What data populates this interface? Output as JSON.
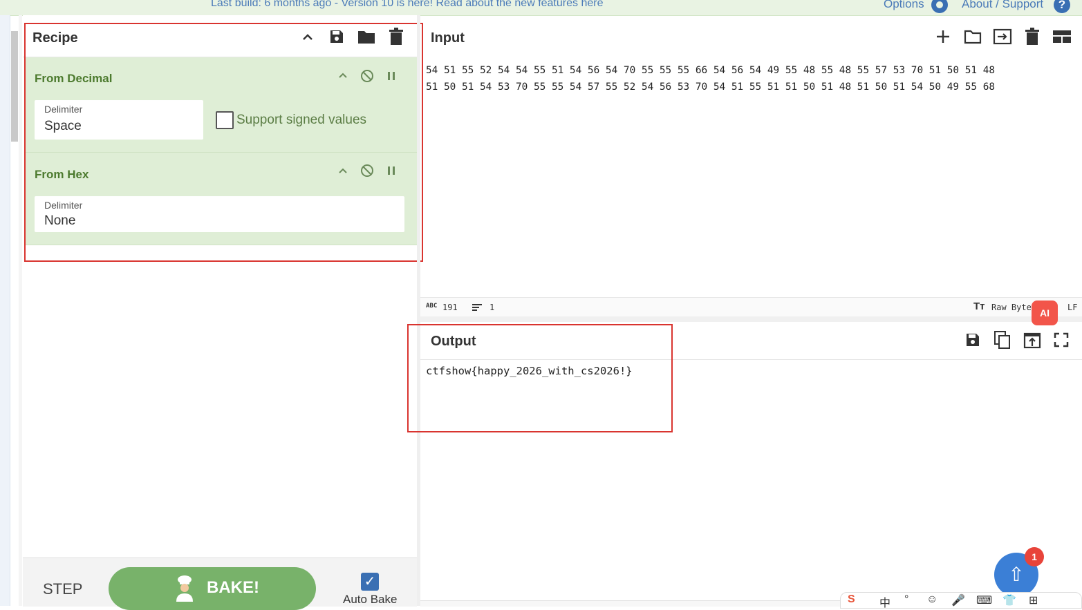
{
  "topbar": {
    "notice": "Last build: 6 months ago - Version 10 is here! Read about the new features",
    "notice_link": "here",
    "options_label": "Options",
    "about_label": "About / Support",
    "help_glyph": "?"
  },
  "recipe": {
    "title": "Recipe",
    "icons": [
      "chevron-up-icon",
      "save-icon",
      "folder-icon",
      "trash-icon"
    ],
    "operations": [
      {
        "title": "From Decimal",
        "delimiter_label": "Delimiter",
        "delimiter_value": "Space",
        "checkbox_label": "Support signed values",
        "checkbox_checked": false
      },
      {
        "title": "From Hex",
        "delimiter_label": "Delimiter",
        "delimiter_value": "None"
      }
    ],
    "step_label": "STEP",
    "bake_label": "BAKE!",
    "auto_bake_label": "Auto Bake",
    "auto_bake_checked": true
  },
  "input": {
    "title": "Input",
    "line1": "54 51 55 52 54 54 55 51 54 56 54 70 55 55 55 66 54 56 54 49 55 48 55 48 55 57 53 70 51 50 51 48",
    "line2": "51 50 51 54 53 70 55 55 54 57 55 52 54 56 53 70 54 51 55 51 51 50 51 48 51 50 51 54 50 49 55 68",
    "status_chars": "191",
    "status_lines": "1",
    "encoding": "Raw Byte",
    "eol": "LF"
  },
  "output": {
    "title": "Output",
    "text": "ctfshow{happy_2026_with_cs2026!}"
  },
  "overlay": {
    "ai_label": "AI",
    "notif_count": "1",
    "ime_items": [
      "S",
      "中",
      "°",
      "☺",
      "🎤",
      "⌨",
      "👕",
      "⊞"
    ]
  },
  "colors": {
    "accent": "#3a6fb3",
    "op_bg": "#dfeed6",
    "bake": "#78b26a",
    "highlight": "#d9342f"
  }
}
